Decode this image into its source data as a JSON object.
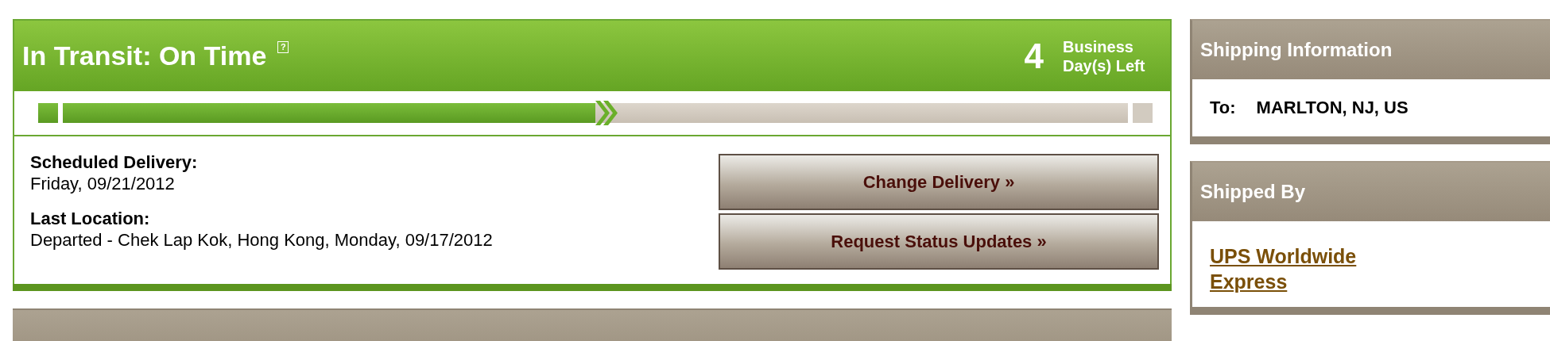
{
  "status": {
    "title": "In Transit: On Time",
    "help": "?",
    "days_left": "4",
    "days_label": "Business Day(s) Left"
  },
  "progress": {
    "level": 0.5
  },
  "details": [
    {
      "label": "Scheduled Delivery:",
      "value": "Friday, 09/21/2012"
    },
    {
      "label": "Last Location:",
      "value": "Departed - Chek Lap Kok, Hong Kong, Monday, 09/17/2012"
    }
  ],
  "buttons": [
    "Change Delivery »",
    "Request Status Updates »"
  ],
  "sidebar": [
    {
      "title": "Shipping Information",
      "kind": "address",
      "label": "To:",
      "value": "MARLTON, NJ, US"
    },
    {
      "title": "Shipped By",
      "kind": "link",
      "value": "UPS Worldwide Express"
    }
  ]
}
